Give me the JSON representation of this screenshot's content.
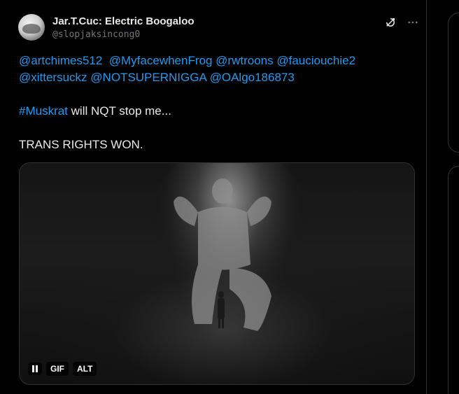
{
  "tweet": {
    "display_name": "Jar.T.Cuc: Electric Boogaloo",
    "handle": "@slopjaksincong0",
    "icons": {
      "grok": "grok-icon",
      "more": "more-icon"
    },
    "body": {
      "line1": [
        "@artchimes512",
        "@MyfacewhenFrog",
        "@rwtroons",
        "@fauciouchie2"
      ],
      "line2": [
        "@xittersuckz",
        "@NOTSUPERNIGGA",
        "@OAlgo186873"
      ],
      "hashtag": "#Muskrat",
      "hashtag_rest": " will NQT stop me...",
      "final_line": "TRANS RIGHTS WON."
    },
    "media": {
      "gif_label": "GIF",
      "alt_label": "ALT"
    }
  },
  "colors": {
    "background": "#000000",
    "text": "#e7e9ea",
    "secondary": "#71767b",
    "link": "#1d9bf0",
    "border": "#2f3336"
  }
}
